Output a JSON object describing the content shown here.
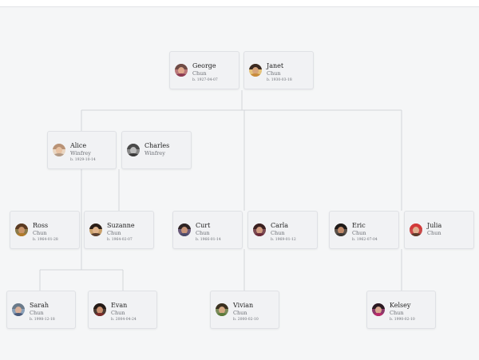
{
  "people": {
    "george": {
      "name": "George",
      "surname": "Chun",
      "dates": "b. 1927-04-07",
      "avatar": "george-portrait-icon"
    },
    "janet": {
      "name": "Janet",
      "surname": "Chun",
      "dates": "b. 1930-03-18",
      "avatar": "janet-portrait-icon"
    },
    "alice": {
      "name": "Alice",
      "surname": "Winfrey",
      "dates": "b. 1929-10-14",
      "avatar": "alice-portrait-icon"
    },
    "charles": {
      "name": "Charles",
      "surname": "Winfrey",
      "dates": "",
      "avatar": "charles-portrait-icon"
    },
    "ross": {
      "name": "Ross",
      "surname": "Chun",
      "dates": "b. 1964-01-28",
      "avatar": "ross-portrait-icon"
    },
    "suzanne": {
      "name": "Suzanne",
      "surname": "Chun",
      "dates": "b. 1964-02-07",
      "avatar": "suzanne-portrait-icon"
    },
    "curt": {
      "name": "Curt",
      "surname": "Chun",
      "dates": "b. 1966-01-14",
      "avatar": "curt-portrait-icon"
    },
    "carla": {
      "name": "Carla",
      "surname": "Chun",
      "dates": "b. 1969-01-12",
      "avatar": "carla-portrait-icon"
    },
    "eric": {
      "name": "Eric",
      "surname": "Chun",
      "dates": "b. 1962-07-04",
      "avatar": "eric-portrait-icon"
    },
    "julia": {
      "name": "Julia",
      "surname": "Chun",
      "dates": "",
      "avatar": "julia-portrait-icon"
    },
    "sarah": {
      "name": "Sarah",
      "surname": "Chun",
      "dates": "b. 1998-12-18",
      "avatar": "sarah-portrait-icon"
    },
    "evan": {
      "name": "Evan",
      "surname": "Chun",
      "dates": "b. 2004-04-24",
      "avatar": "evan-portrait-icon"
    },
    "vivian": {
      "name": "Vivian",
      "surname": "Chun",
      "dates": "b. 2000-02-10",
      "avatar": "vivian-portrait-icon"
    },
    "kelsey": {
      "name": "Kelsey",
      "surname": "Chun",
      "dates": "b. 1990-02-10",
      "avatar": "kelsey-portrait-icon"
    }
  },
  "colors": {
    "connector": "#d2d5da",
    "card_background": "#f1f2f4",
    "card_border": "#dfe1e5",
    "name_text": "#222222",
    "secondary_text": "#6c6f75"
  }
}
